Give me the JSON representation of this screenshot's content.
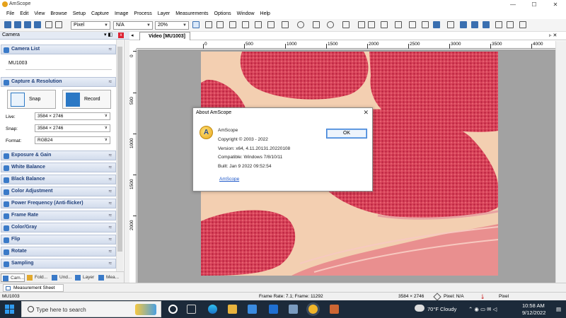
{
  "window": {
    "title": "AmScope",
    "min": "—",
    "max": "☐",
    "close": "✕"
  },
  "menu": [
    "File",
    "Edit",
    "View",
    "Browse",
    "Setup",
    "Capture",
    "Image",
    "Process",
    "Layer",
    "Measurements",
    "Options",
    "Window",
    "Help"
  ],
  "toolbar": {
    "unit": "Pixel",
    "na": "N/A",
    "zoom": "20%"
  },
  "left_panel": {
    "header": "Camera",
    "camera_list": {
      "label": "Camera List",
      "item": "MU1003"
    },
    "capture": {
      "label": "Capture & Resolution",
      "snap": "Snap",
      "record": "Record",
      "live_label": "Live:",
      "live_value": "3584 × 2746",
      "snap_label": "Snap:",
      "snap_value": "3584 × 2746",
      "format_label": "Format:",
      "format_value": "RGB24"
    },
    "sections": [
      "Exposure & Gain",
      "White Balance",
      "Black Balance",
      "Color Adjustment",
      "Power Frequency (Anti-flicker)",
      "Frame Rate",
      "Color/Gray",
      "Flip",
      "Rotate",
      "Sampling"
    ],
    "tabs": [
      "Cam...",
      "Fold...",
      "Und...",
      "Layer",
      "Mea..."
    ]
  },
  "document": {
    "tab": "Video [MU1003]",
    "ruler_h": [
      "0",
      "500",
      "1000",
      "1500",
      "2000",
      "2500",
      "3000",
      "3500",
      "4000"
    ],
    "ruler_v": [
      "0",
      "500",
      "1000",
      "1500",
      "2000"
    ]
  },
  "dialog": {
    "title": "About AmScope",
    "logo_letter": "A",
    "product": "AmScope",
    "copyright": "Copyright © 2003 - 2022",
    "version": "Version: x64, 4.11.20131.20220108",
    "compatible": "Compatible: Windows 7/8/10/11",
    "built": "Built: Jan  9 2022 09:52:54",
    "link": "AmScope",
    "ok": "OK"
  },
  "sheet_tab": "Measurement Sheet",
  "status": {
    "camera": "MU1003",
    "frame": "Frame Rate: 7.1; Frame: 11292",
    "resolution": "3584 × 2746",
    "pixel": "Pixel: N/A",
    "unit": "Pixel"
  },
  "taskbar": {
    "search_placeholder": "Type here to search",
    "weather": "70°F  Cloudy",
    "time": "10:58 AM",
    "date": "9/12/2022"
  }
}
